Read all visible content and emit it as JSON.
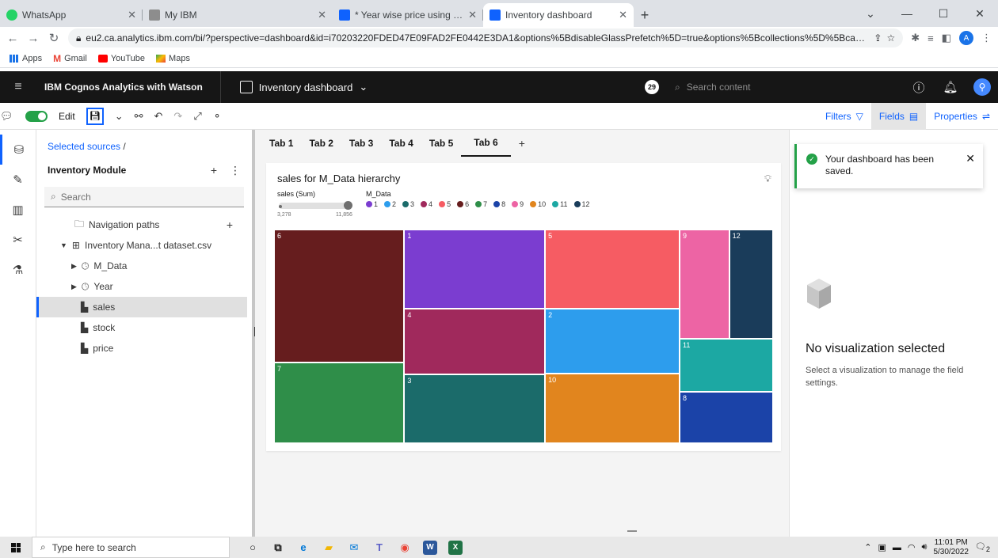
{
  "browser": {
    "tabs": [
      {
        "title": "WhatsApp",
        "favicon_color": "#25d366"
      },
      {
        "title": "My IBM",
        "favicon_color": "#6f6f6f"
      },
      {
        "title": "* Year wise price using Line grapl",
        "favicon_color": "#0f62fe"
      },
      {
        "title": "Inventory dashboard",
        "favicon_color": "#0f62fe"
      }
    ],
    "url": "eu2.ca.analytics.ibm.com/bi/?perspective=dashboard&id=i70203220FDED47E09FAD2FE0442E3DA1&options%5BdisableGlassPrefetch%5D=true&options%5Bcollections%5D%5BcanvasE...",
    "profile_initial": "A",
    "bookmarks": [
      {
        "label": "Apps",
        "icon": "apps-grid-icon"
      },
      {
        "label": "Gmail",
        "icon": "gmail-icon"
      },
      {
        "label": "YouTube",
        "icon": "youtube-icon"
      },
      {
        "label": "Maps",
        "icon": "maps-icon"
      }
    ]
  },
  "app": {
    "brand": "IBM Cognos Analytics with Watson",
    "dashboard_title": "Inventory dashboard",
    "notification_count": "29",
    "search_placeholder": "Search content"
  },
  "toolbar": {
    "edit_label": "Edit",
    "filters_label": "Filters",
    "fields_label": "Fields",
    "properties_label": "Properties"
  },
  "sources": {
    "breadcrumb": "Selected sources",
    "breadcrumb_sep": "/",
    "module_name": "Inventory Module",
    "search_placeholder": "Search",
    "tree": [
      {
        "label": "Navigation paths",
        "icon": "folder-icon"
      },
      {
        "label": "Inventory Mana...t dataset.csv",
        "icon": "table-icon"
      },
      {
        "label": "M_Data",
        "icon": "clock-icon"
      },
      {
        "label": "Year",
        "icon": "clock-icon"
      },
      {
        "label": "sales",
        "icon": "measure-icon"
      },
      {
        "label": "stock",
        "icon": "measure-icon"
      },
      {
        "label": "price",
        "icon": "measure-icon"
      }
    ]
  },
  "canvas": {
    "tabs": [
      "Tab 1",
      "Tab 2",
      "Tab 3",
      "Tab 4",
      "Tab 5",
      "Tab 6"
    ],
    "active_tab": 5
  },
  "viz": {
    "title": "sales for M_Data hierarchy",
    "size_legend_label": "sales (Sum)",
    "size_min": "3,278",
    "size_max": "11,856",
    "color_legend_label": "M_Data"
  },
  "chart_data": {
    "type": "treemap",
    "title": "sales for M_Data hierarchy",
    "size_measure": "sales (Sum)",
    "color_dimension": "M_Data",
    "size_range": [
      3278,
      11856
    ],
    "items": [
      {
        "label": "6",
        "value": 11856,
        "color": "#661d1e"
      },
      {
        "label": "7",
        "value": 7200,
        "color": "#2f8e49"
      },
      {
        "label": "1",
        "value": 7600,
        "color": "#7b3dd0"
      },
      {
        "label": "4",
        "value": 6400,
        "color": "#a0295c"
      },
      {
        "label": "3",
        "value": 6600,
        "color": "#1b6b6a"
      },
      {
        "label": "5",
        "value": 7300,
        "color": "#f65c63"
      },
      {
        "label": "2",
        "value": 6000,
        "color": "#2d9ded"
      },
      {
        "label": "10",
        "value": 6400,
        "color": "#e1851e"
      },
      {
        "label": "9",
        "value": 3700,
        "color": "#ed64a4"
      },
      {
        "label": "12",
        "value": 3278,
        "color": "#1a3c5a"
      },
      {
        "label": "11",
        "value": 3400,
        "color": "#1ca8a3"
      },
      {
        "label": "8",
        "value": 3300,
        "color": "#1b43a8"
      }
    ],
    "legend": [
      "1",
      "2",
      "3",
      "4",
      "5",
      "6",
      "7",
      "8",
      "9",
      "10",
      "11",
      "12"
    ]
  },
  "rpanel": {
    "toast_message": "Your dashboard has been saved.",
    "empty_title": "No visualization selected",
    "empty_desc": "Select a visualization to manage the field settings."
  },
  "taskbar": {
    "search_placeholder": "Type here to search",
    "time": "11:01 PM",
    "date": "5/30/2022",
    "notif_count": "2"
  }
}
